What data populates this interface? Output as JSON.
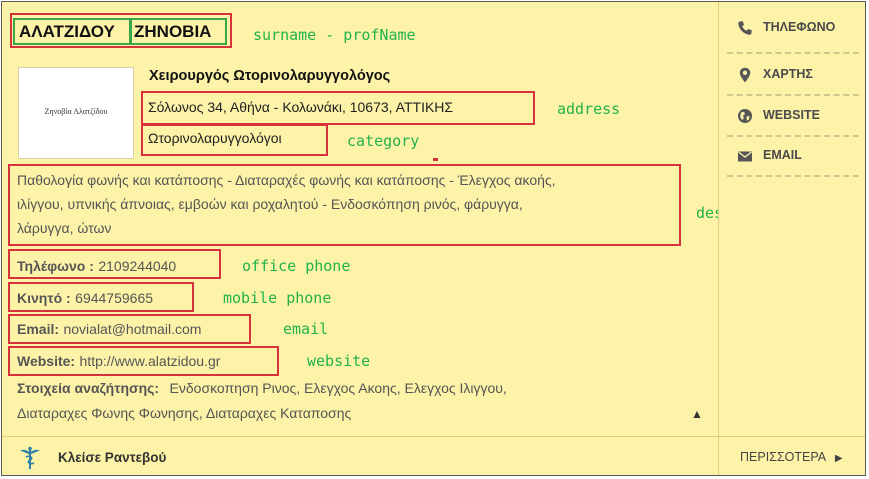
{
  "header": {
    "surname": "ΑΛΑΤΖΙΔΟΥ",
    "prof_name": "ΖΗΝΟΒΙΑ"
  },
  "logo": {
    "text": "Ζηνοβία Αλατζίδου"
  },
  "profession": "Χειρουργός Ωτορινολαρυγγολόγος",
  "address": "Σόλωνος 34, Αθήνα - Κολωνάκι, 10673, ΑΤΤΙΚΗΣ",
  "category": "Ωτορινολαρυγγολόγοι",
  "description": {
    "line1": "Παθολογία φωνής και κατάποσης - Διαταραχές φωνής και κατάποσης - Έλεγχος ακοής,",
    "line2": "ιλίγγου, υπνικής άπνοιας, εμβοών και ροχαλητού - Ενδοσκόπηση ρινός, φάρυγγα,",
    "line3": "λάρυγγα, ώτων"
  },
  "contact": {
    "phone_label": "Τηλέφωνο :",
    "phone_value": "2109244040",
    "mobile_label": "Κινητό :",
    "mobile_value": "6944759665",
    "email_label": "Email:",
    "email_value": "novialat@hotmail.com",
    "website_label": "Website:",
    "website_value": "http://www.alatzidou.gr"
  },
  "search_terms": {
    "label": "Στοιχεία αναζήτησης:",
    "line1": "Ενδοσκοπηση Ρινος,   Ελεγχος Ακοης,   Ελεγχος Ιλιγγου,",
    "line2": "Διαταραχες Φωνης Φωνησης,   Διαταραχες Καταποσης"
  },
  "sidebar": {
    "items": [
      {
        "label": "ΤΗΛΕΦΩΝΟ",
        "icon": "phone-icon"
      },
      {
        "label": "ΧΑΡΤΗΣ",
        "icon": "map-pin-icon"
      },
      {
        "label": "WEBSITE",
        "icon": "globe-icon"
      },
      {
        "label": "EMAIL",
        "icon": "envelope-icon"
      }
    ]
  },
  "footer": {
    "appointment_label": "Κλείσε Ραντεβού",
    "more_label": "ΠΕΡΙΣΣΟΤΕΡΑ",
    "more_arrow": "▶",
    "collapse_arrow": "▲"
  },
  "annotations": {
    "surname": "surname - profName",
    "address": "address",
    "category": "category",
    "description": "description",
    "office_phone": "office phone",
    "mobile_phone": "mobile phone",
    "email": "email",
    "website": "website"
  },
  "colors": {
    "card_bg": "#fcf3a8",
    "annotation_box": "#d8323c",
    "annotation_text": "#22b24c",
    "name_box": "#3aa64a"
  }
}
